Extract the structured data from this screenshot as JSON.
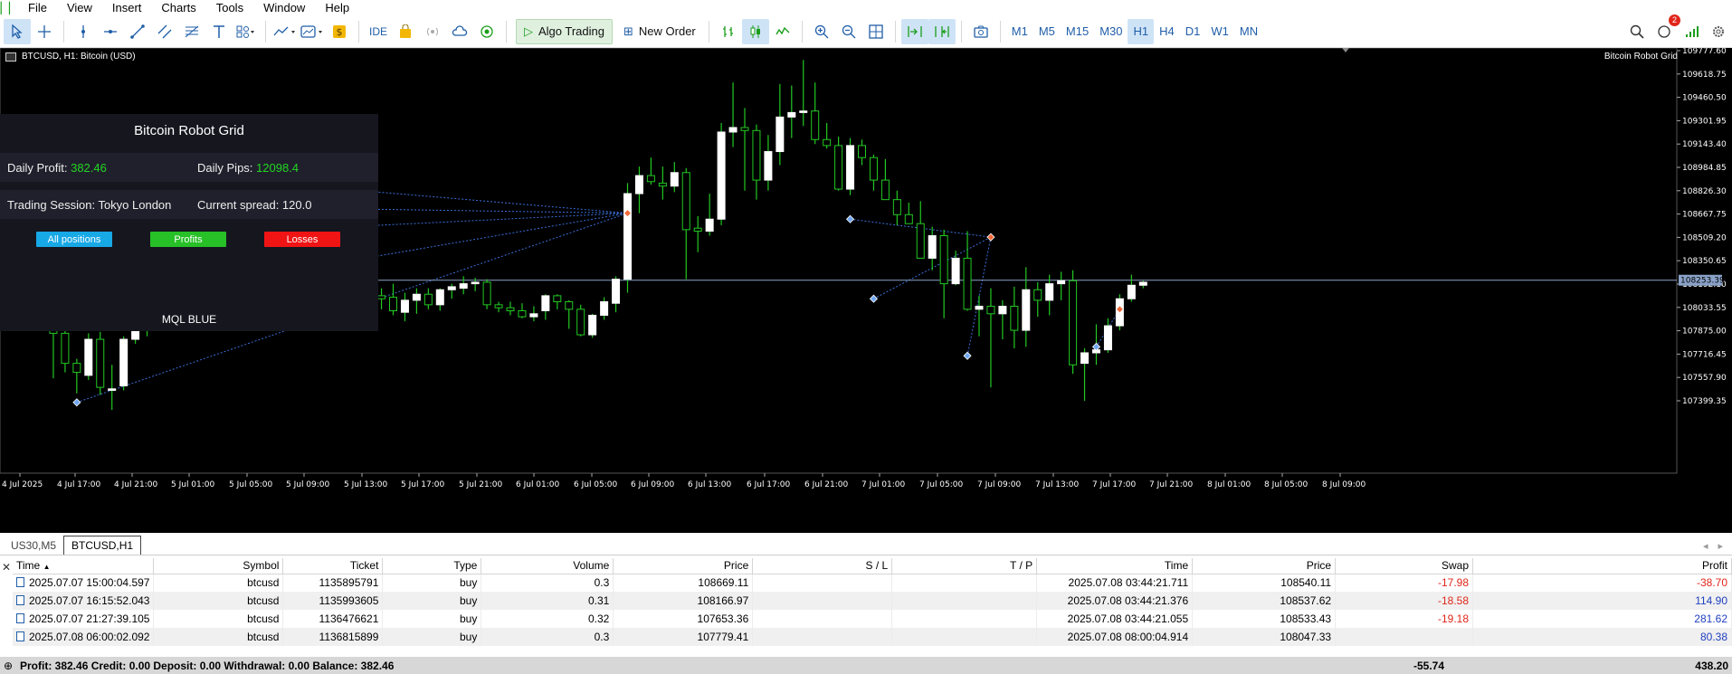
{
  "menu": [
    "File",
    "View",
    "Insert",
    "Charts",
    "Tools",
    "Window",
    "Help"
  ],
  "toolbar": {
    "ide_label": "IDE",
    "algo_label": "Algo Trading",
    "new_order_label": "New Order",
    "timeframes": [
      "M1",
      "M5",
      "M15",
      "M30",
      "H1",
      "H4",
      "D1",
      "W1",
      "MN"
    ],
    "active_timeframe": "H1",
    "notifications": "2"
  },
  "chart": {
    "symbol_title": "BTCUSD, H1:  Bitcoin (USD)",
    "ea_name": "Bitcoin Robot Grid",
    "current_price": "108253.39",
    "colors": {
      "bg": "#000000",
      "bull": "#ffffff",
      "wick": "#22c922",
      "trendline": "#3a6fd8"
    }
  },
  "robot_panel": {
    "title": "Bitcoin Robot Grid",
    "daily_profit_label": "Daily Profit:",
    "daily_profit_value": "382.46",
    "daily_pips_label": "Daily Pips:",
    "daily_pips_value": "12098.4",
    "session_label": "Trading Session: Tokyo London",
    "spread_label": "Current spread: 120.0",
    "btn_all": "All positions",
    "btn_profits": "Profits",
    "btn_losses": "Losses",
    "footer": "MQL BLUE"
  },
  "chart_data": {
    "type": "candlestick",
    "y_ticks": [
      "109777.60",
      "109618.75",
      "109460.50",
      "109301.95",
      "109143.40",
      "108984.85",
      "108826.30",
      "108667.75",
      "108509.20",
      "108350.65",
      "108192.10",
      "108033.55",
      "107875.00",
      "107716.45",
      "107557.90",
      "107399.35"
    ],
    "x_ticks": [
      "4 Jul 2025",
      "4 Jul 17:00",
      "4 Jul 21:00",
      "5 Jul 01:00",
      "5 Jul 05:00",
      "5 Jul 09:00",
      "5 Jul 13:00",
      "5 Jul 17:00",
      "5 Jul 21:00",
      "6 Jul 01:00",
      "6 Jul 05:00",
      "6 Jul 09:00",
      "6 Jul 13:00",
      "6 Jul 17:00",
      "6 Jul 21:00",
      "7 Jul 01:00",
      "7 Jul 05:00",
      "7 Jul 09:00",
      "7 Jul 13:00",
      "7 Jul 17:00",
      "7 Jul 21:00",
      "8 Jul 01:00",
      "8 Jul 05:00",
      "8 Jul 09:00"
    ],
    "ylim": [
      107300,
      109800
    ],
    "candles": [
      [
        108300,
        108560,
        108090,
        108540
      ],
      [
        108090,
        108110,
        107600,
        107900
      ],
      [
        107900,
        107990,
        107640,
        107700
      ],
      [
        107700,
        107730,
        107500,
        107640
      ],
      [
        107620,
        107900,
        107590,
        107860
      ],
      [
        107860,
        107910,
        107490,
        107540
      ],
      [
        107520,
        107690,
        107390,
        107530
      ],
      [
        107550,
        107880,
        107520,
        107860
      ],
      [
        107860,
        107930,
        107830,
        107920
      ],
      [
        107920,
        108280,
        107880,
        108270
      ],
      [
        108270,
        108290,
        107990,
        108050
      ],
      [
        108050,
        108200,
        107960,
        108150
      ],
      [
        108150,
        108230,
        107990,
        108020
      ],
      [
        108020,
        108280,
        107990,
        108250
      ],
      [
        108160,
        108340,
        108070,
        108160
      ],
      [
        108150,
        108380,
        108040,
        108190
      ],
      [
        108180,
        108240,
        108020,
        108170
      ],
      [
        108170,
        108300,
        108050,
        108280
      ],
      [
        108280,
        108330,
        108090,
        108130
      ],
      [
        108120,
        108180,
        107920,
        108080
      ],
      [
        108080,
        108150,
        108010,
        108100
      ],
      [
        108100,
        108230,
        108040,
        108150
      ],
      [
        108150,
        108180,
        108060,
        108120
      ],
      [
        108110,
        108190,
        108080,
        108130
      ],
      [
        108130,
        108200,
        108080,
        108170
      ],
      [
        108170,
        108210,
        108120,
        108150
      ],
      [
        108160,
        108250,
        108060,
        108220
      ],
      [
        108220,
        108260,
        108060,
        108090
      ],
      [
        108090,
        108180,
        108020,
        108160
      ],
      [
        108150,
        108200,
        108060,
        108130
      ],
      [
        108140,
        108230,
        108020,
        108050
      ],
      [
        108040,
        108170,
        107980,
        108120
      ],
      [
        108120,
        108200,
        108030,
        108160
      ],
      [
        108160,
        108200,
        108060,
        108090
      ],
      [
        108090,
        108200,
        108050,
        108190
      ],
      [
        108190,
        108230,
        108130,
        108210
      ],
      [
        108200,
        108280,
        108160,
        108230
      ],
      [
        108230,
        108270,
        108180,
        108240
      ],
      [
        108240,
        108260,
        108060,
        108090
      ],
      [
        108090,
        108110,
        108040,
        108070
      ],
      [
        108070,
        108110,
        108020,
        108050
      ],
      [
        108050,
        108100,
        108000,
        108010
      ],
      [
        108010,
        108080,
        107980,
        108030
      ],
      [
        108050,
        108160,
        107990,
        108150
      ],
      [
        108150,
        108160,
        108060,
        108110
      ],
      [
        108110,
        108120,
        107930,
        108060
      ],
      [
        108060,
        108090,
        107880,
        107890
      ],
      [
        107890,
        108030,
        107870,
        108020
      ],
      [
        108020,
        108140,
        107990,
        108110
      ],
      [
        108100,
        108280,
        108040,
        108260
      ],
      [
        108260,
        108900,
        108170,
        108830
      ],
      [
        108830,
        109010,
        108700,
        108950
      ],
      [
        108950,
        109070,
        108890,
        108910
      ],
      [
        108900,
        109010,
        108790,
        108880
      ],
      [
        108880,
        109040,
        108840,
        108970
      ],
      [
        108970,
        109000,
        108260,
        108590
      ],
      [
        108600,
        108680,
        108440,
        108580
      ],
      [
        108580,
        108830,
        108550,
        108660
      ],
      [
        108660,
        109300,
        108620,
        109240
      ],
      [
        109240,
        109570,
        109140,
        109270
      ],
      [
        109270,
        109400,
        108850,
        109250
      ],
      [
        109250,
        109290,
        108790,
        108920
      ],
      [
        108920,
        109220,
        108850,
        109110
      ],
      [
        109110,
        109560,
        109020,
        109340
      ],
      [
        109340,
        109550,
        109200,
        109370
      ],
      [
        109370,
        109720,
        109280,
        109380
      ],
      [
        109380,
        109570,
        109160,
        109190
      ],
      [
        109190,
        109300,
        109130,
        109150
      ],
      [
        109150,
        109210,
        108850,
        108860
      ],
      [
        108860,
        109200,
        108820,
        109150
      ],
      [
        109150,
        109190,
        109020,
        109070
      ],
      [
        109070,
        109090,
        108850,
        108920
      ],
      [
        108920,
        109060,
        108800,
        108790
      ],
      [
        108790,
        108850,
        108620,
        108690
      ],
      [
        108690,
        108770,
        108640,
        108630
      ],
      [
        108630,
        108780,
        108410,
        108400
      ],
      [
        108400,
        108610,
        108320,
        108550
      ],
      [
        108550,
        108590,
        108000,
        108230
      ],
      [
        108230,
        108450,
        108220,
        108400
      ],
      [
        108400,
        108580,
        108050,
        108060
      ],
      [
        108060,
        108150,
        107880,
        108080
      ],
      [
        108080,
        108200,
        107540,
        108030
      ],
      [
        108030,
        108120,
        107860,
        108080
      ],
      [
        108080,
        108210,
        107800,
        107920
      ],
      [
        107920,
        108340,
        107810,
        108190
      ],
      [
        108190,
        108240,
        108010,
        108120
      ],
      [
        108120,
        108290,
        108020,
        108230
      ],
      [
        108230,
        108310,
        108120,
        108250
      ],
      [
        108250,
        108320,
        107630,
        107690
      ],
      [
        107700,
        107800,
        107450,
        107770
      ],
      [
        107770,
        107960,
        107690,
        107790
      ],
      [
        107790,
        108000,
        107770,
        107950
      ],
      [
        107950,
        108160,
        107920,
        108130
      ],
      [
        108130,
        108290,
        108110,
        108220
      ],
      [
        108220,
        108250,
        108200,
        108240
      ]
    ],
    "trade_markers": [
      {
        "i": 0,
        "price": 108510,
        "kind": "open-buy"
      },
      {
        "i": 0,
        "price": 108030,
        "kind": "open-buy"
      },
      {
        "i": 3,
        "price": 107440,
        "kind": "open-buy"
      },
      {
        "i": 50,
        "price": 108700,
        "kind": "close-sell"
      },
      {
        "i": 69,
        "price": 108660,
        "kind": "open-buy"
      },
      {
        "i": 71,
        "price": 108130,
        "kind": "open-buy"
      },
      {
        "i": 79,
        "price": 107750,
        "kind": "open-buy"
      },
      {
        "i": 81,
        "price": 108540,
        "kind": "close-sell"
      },
      {
        "i": 90,
        "price": 107810,
        "kind": "open-buy"
      },
      {
        "i": 92,
        "price": 108060,
        "kind": "close-sell"
      }
    ],
    "trend_lines": [
      [
        [
          0,
          108760
        ],
        [
          50,
          108700
        ]
      ],
      [
        [
          0,
          108510
        ],
        [
          50,
          108700
        ]
      ],
      [
        [
          0,
          108030
        ],
        [
          50,
          108700
        ]
      ],
      [
        [
          3,
          107440
        ],
        [
          50,
          108700
        ]
      ],
      [
        [
          69,
          108660
        ],
        [
          81,
          108540
        ]
      ],
      [
        [
          71,
          108130
        ],
        [
          81,
          108540
        ]
      ],
      [
        [
          79,
          107750
        ],
        [
          81,
          108540
        ]
      ],
      [
        [
          90,
          107810
        ],
        [
          92,
          108060
        ]
      ]
    ]
  },
  "tabs": [
    "US30,M5",
    "BTCUSD,H1"
  ],
  "active_tab": "BTCUSD,H1",
  "trade": {
    "headers": [
      "Time",
      "Symbol",
      "Ticket",
      "Type",
      "Volume",
      "Price",
      "S / L",
      "T / P",
      "Time",
      "Price",
      "Swap",
      "Profit"
    ],
    "rows": [
      {
        "time": "2025.07.07 15:00:04.597",
        "symbol": "btcusd",
        "ticket": "1135895791",
        "type": "buy",
        "volume": "0.3",
        "price": "108669.11",
        "sl": "",
        "tp": "",
        "close_time": "2025.07.08 03:44:21.711",
        "close_price": "108540.11",
        "swap": "-17.98",
        "profit": "-38.70"
      },
      {
        "time": "2025.07.07 16:15:52.043",
        "symbol": "btcusd",
        "ticket": "1135993605",
        "type": "buy",
        "volume": "0.31",
        "price": "108166.97",
        "sl": "",
        "tp": "",
        "close_time": "2025.07.08 03:44:21.376",
        "close_price": "108537.62",
        "swap": "-18.58",
        "profit": "114.90"
      },
      {
        "time": "2025.07.07 21:27:39.105",
        "symbol": "btcusd",
        "ticket": "1136476621",
        "type": "buy",
        "volume": "0.32",
        "price": "107653.36",
        "sl": "",
        "tp": "",
        "close_time": "2025.07.08 03:44:21.055",
        "close_price": "108533.43",
        "swap": "-19.18",
        "profit": "281.62"
      },
      {
        "time": "2025.07.08 06:00:02.092",
        "symbol": "btcusd",
        "ticket": "1136815899",
        "type": "buy",
        "volume": "0.3",
        "price": "107779.41",
        "sl": "",
        "tp": "",
        "close_time": "2025.07.08 08:00:04.914",
        "close_price": "108047.33",
        "swap": "",
        "profit": "80.38"
      }
    ],
    "summary": "Profit: 382.46  Credit: 0.00  Deposit: 0.00  Withdrawal: 0.00  Balance: 382.46",
    "total_swap": "-55.74",
    "total_profit": "438.20"
  }
}
